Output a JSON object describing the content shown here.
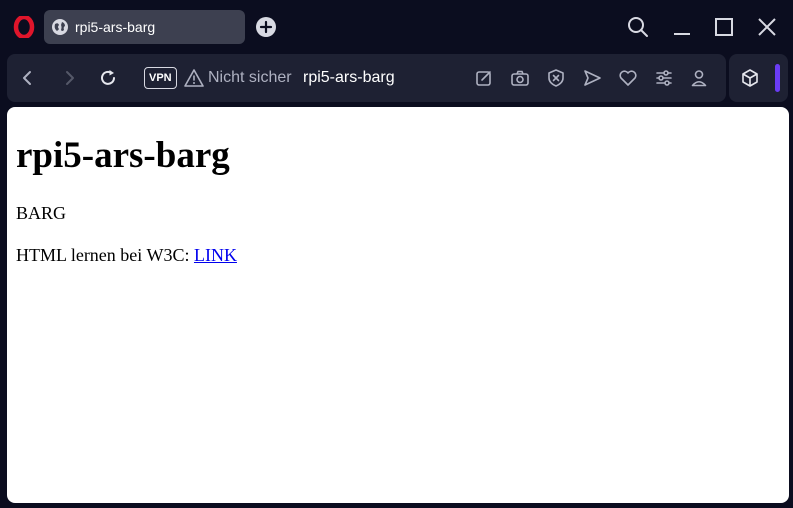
{
  "tab": {
    "title": "rpi5-ars-barg"
  },
  "addressbar": {
    "vpn_label": "VPN",
    "security_text": "Nicht sicher",
    "url": "rpi5-ars-barg"
  },
  "page": {
    "heading": "rpi5-ars-barg",
    "paragraph1": "BARG",
    "paragraph2_text": "HTML lernen bei W3C: ",
    "link_text": "LINK"
  },
  "colors": {
    "browser_background": "#0b0d1f",
    "toolbar_background": "#1e2133",
    "active_tab": "#3d4050",
    "opera_red": "#e0152b",
    "sidebar_accent": "#6a3cf5",
    "link": "#0000ee"
  },
  "icons": [
    "opera-logo-icon",
    "globe-icon",
    "plus-icon",
    "search-icon",
    "minimize-icon",
    "maximize-icon",
    "close-icon",
    "back-icon",
    "forward-icon",
    "reload-icon",
    "warning-icon",
    "edit-icon",
    "camera-icon",
    "shield-icon",
    "send-icon",
    "heart-icon",
    "settings-icon",
    "user-icon",
    "cube-icon"
  ]
}
